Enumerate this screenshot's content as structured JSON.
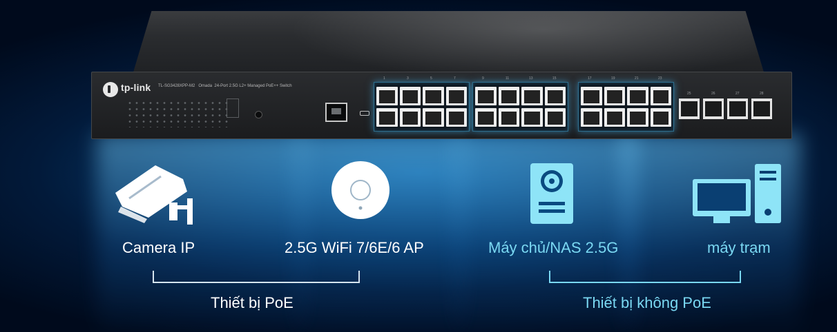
{
  "switch": {
    "brand": "tp-link",
    "model_text": "TL-SG3428XPP-M2",
    "series_text": "Omada",
    "description": "24-Port 2.5G L2+ Managed PoE++ Switch",
    "port_numbers_top": [
      "1",
      "3",
      "5",
      "7",
      "9",
      "11",
      "13",
      "15",
      "17",
      "19",
      "21",
      "23"
    ],
    "sfp_numbers": [
      "25",
      "26",
      "27",
      "28"
    ]
  },
  "devices": [
    {
      "label": "Camera IP",
      "icon": "security-camera-icon"
    },
    {
      "label": "2.5G WiFi 7/6E/6 AP",
      "icon": "access-point-icon"
    },
    {
      "label": "Máy chủ/NAS 2.5G",
      "icon": "nas-server-icon"
    },
    {
      "label": "máy trạm",
      "icon": "workstation-icon"
    }
  ],
  "groups": {
    "poe": "Thiết bị PoE",
    "non_poe": "Thiết bị không PoE"
  },
  "colors": {
    "poe_text": "#ffffff",
    "non_poe_text": "#7ad8f2",
    "icon_white": "#ffffff",
    "icon_cyan": "#8ee4f7"
  }
}
